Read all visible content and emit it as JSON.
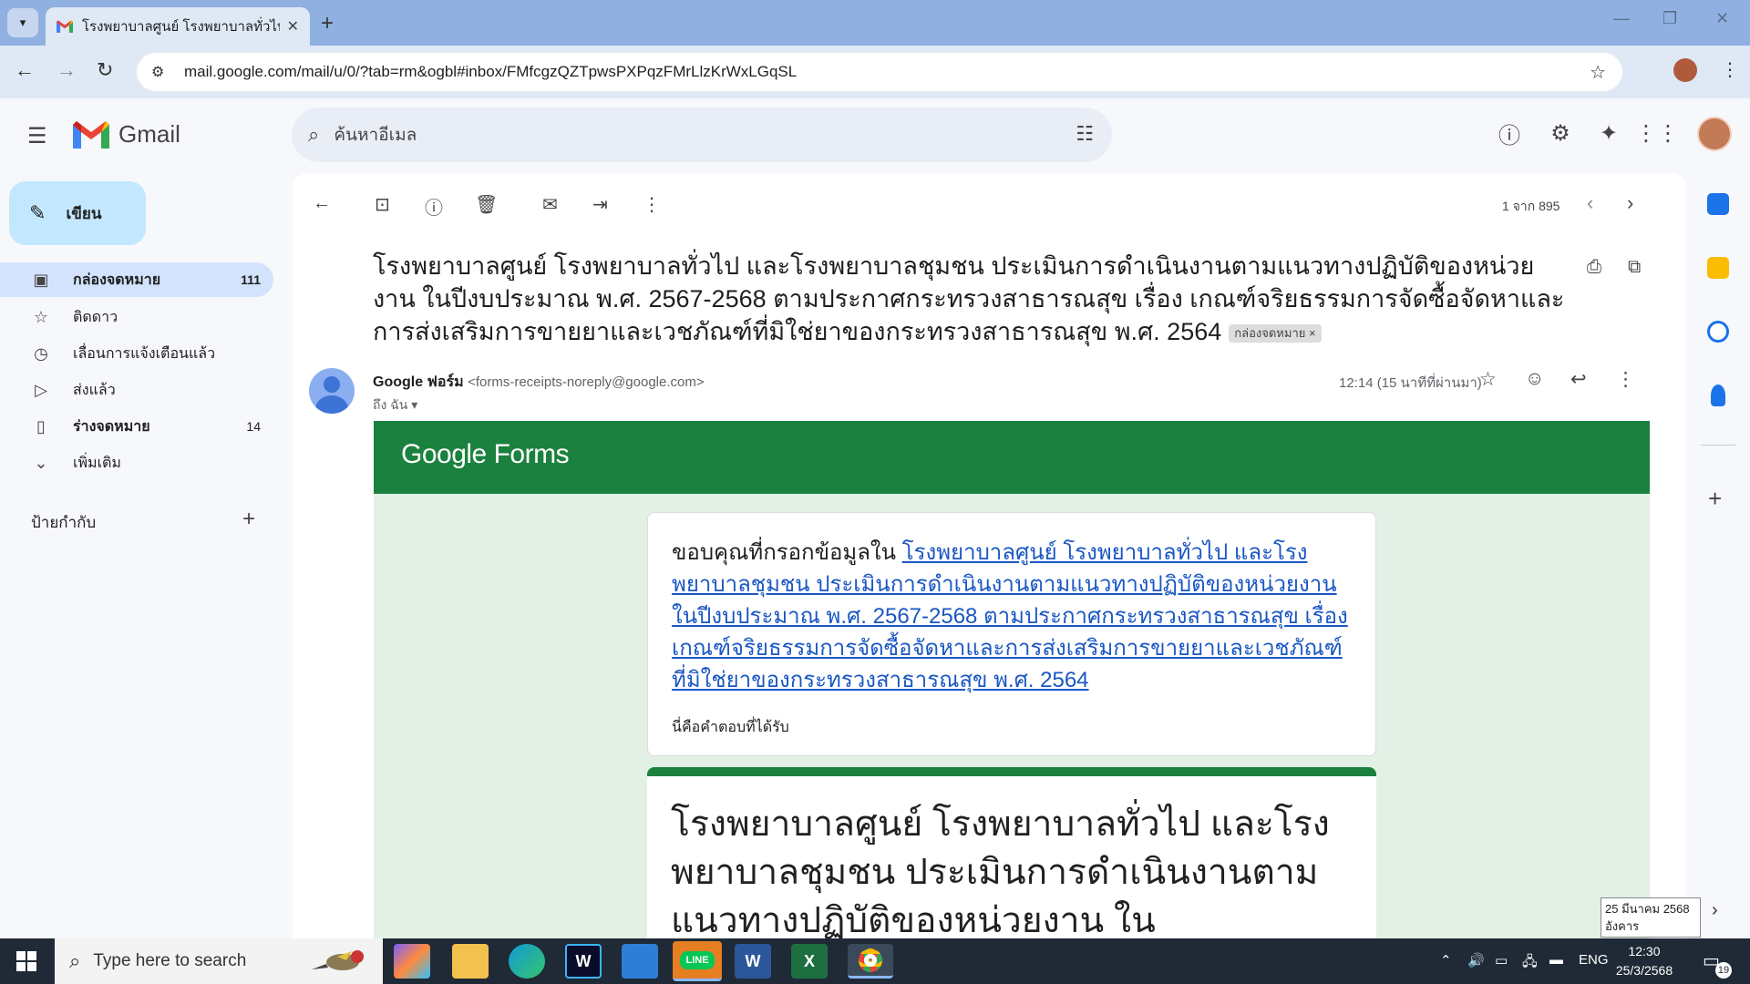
{
  "browser": {
    "tab_title": "โรงพยาบาลศูนย์ โรงพยาบาลทั่วไป แล",
    "url": "mail.google.com/mail/u/0/?tab=rm&ogbl#inbox/FMfcgzQZTpwsPXPqzFMrLlzKrWxLGqSL"
  },
  "gmail": {
    "wordmark": "Gmail",
    "search_placeholder": "ค้นหาอีเมล",
    "compose_label": "เขียน",
    "nav": [
      {
        "label": "กล่องจดหมาย",
        "count": "111",
        "icon": "inbox-icon"
      },
      {
        "label": "ติดดาว",
        "count": "",
        "icon": "star-icon"
      },
      {
        "label": "เลื่อนการแจ้งเตือนแล้ว",
        "count": "",
        "icon": "clock-icon"
      },
      {
        "label": "ส่งแล้ว",
        "count": "",
        "icon": "send-icon"
      },
      {
        "label": "ร่างจดหมาย",
        "count": "14",
        "icon": "draft-icon"
      },
      {
        "label": "เพิ่มเติม",
        "count": "",
        "icon": "chevron-down-icon"
      }
    ],
    "labels_header": "ป้ายกำกับ",
    "pager_text": "1 จาก 895",
    "subject": "โรงพยาบาลศูนย์ โรงพยาบาลทั่วไป และโรงพยาบาลชุมชน ประเมินการดำเนินงานตามแนวทางปฏิบัติของหน่วยงาน ในปีงบประมาณ พ.ศ. 2567-2568 ตามประกาศกระทรวงสาธารณสุข เรื่อง เกณฑ์จริยธรรมการจัดซื้อจัดหาและการส่งเสริมการขายยาและเวชภัณฑ์ที่มิใช่ยาของกระทรวงสาธารณสุข พ.ศ. 2564",
    "subject_chip": "กล่องจดหมาย",
    "sender_name": "Google ฟอร์ม",
    "sender_email": "<forms-receipts-noreply@google.com>",
    "to_line": "ถึง ฉัน",
    "time": "12:14 (15 นาทีที่ผ่านมา)"
  },
  "email_body": {
    "forms_logo": "Google Forms",
    "thanks_prefix": "ขอบคุณที่กรอกข้อมูลใน ",
    "thanks_link": "โรงพยาบาลศูนย์ โรงพยาบาลทั่วไป และโรงพยาบาลชุมชน ประเมินการดำเนินงานตามแนวทางปฏิบัติของหน่วยงาน ในปีงบประมาณ พ.ศ. 2567-2568 ตามประกาศกระทรวงสาธารณสุข เรื่อง เกณฑ์จริยธรรมการจัดซื้อจัดหาและการส่งเสริมการขายยาและเวชภัณฑ์ที่มิใช่ยาของกระทรวงสาธารณสุข พ.ศ. 2564",
    "response_note": "นี่คือคำตอบที่ได้รับ",
    "form_title": "โรงพยาบาลศูนย์ โรงพยาบาลทั่วไป และโรงพยาบาลชุมชน ประเมินการดำเนินงานตามแนวทางปฏิบัติของหน่วยงาน ในปีงบประมาณ"
  },
  "tooltip": {
    "date": "25 มีนาคม 2568",
    "weekday": "อังคาร"
  },
  "taskbar": {
    "search_placeholder": "Type here to search",
    "lang": "ENG",
    "time": "12:30",
    "date": "25/3/2568",
    "notif_count": "19"
  },
  "colors": {
    "forms_green": "#1b813e",
    "forms_body_bg": "#e2f0e6",
    "nav_active": "#d3e3fd",
    "compose_bg": "#c2e7ff",
    "link": "#1a57c4"
  }
}
